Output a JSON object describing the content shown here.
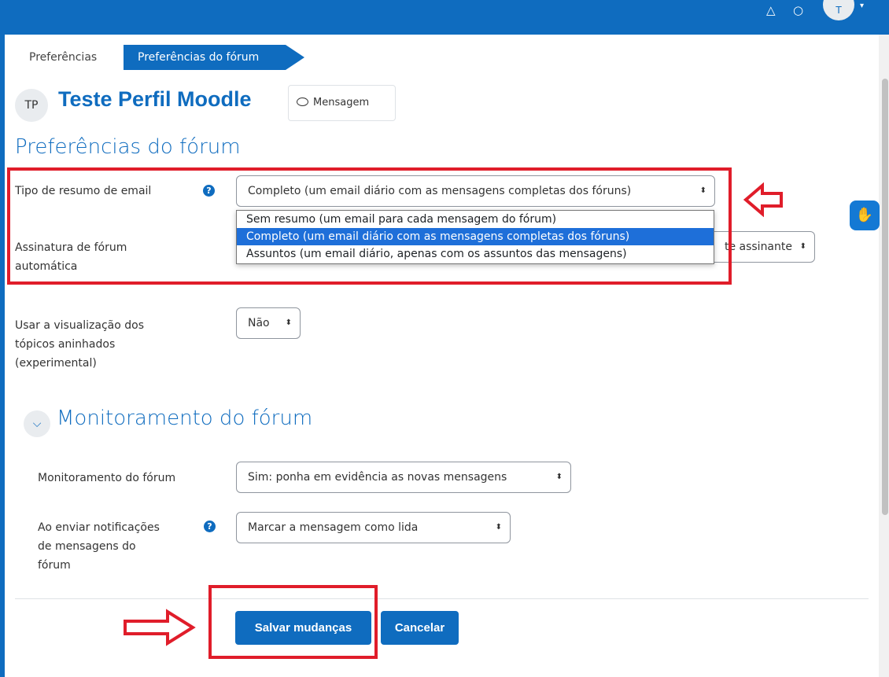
{
  "nav": {
    "avatar_initials": "T",
    "bell_icon": "bell-icon",
    "chat_icon": "chat-icon"
  },
  "breadcrumb": {
    "items": [
      "Preferências",
      "Preferências do fórum"
    ]
  },
  "profile": {
    "initials": "TP",
    "name": "Teste Perfil Moodle",
    "message_button": "Mensagem"
  },
  "page_title": "Preferências do fórum",
  "fields": {
    "digest": {
      "label": "Tipo de resumo de email",
      "value": "Completo (um email diário com as mensagens completas dos fóruns)",
      "options": [
        "Sem resumo (um email para cada mensagem do fórum)",
        "Completo (um email diário com as mensagens completas dos fóruns)",
        "Assuntos (um email diário, apenas com os assuntos das mensagens)"
      ],
      "selected_index": 1
    },
    "autosubscribe": {
      "label_line1": "Assinatura de fórum",
      "label_line2": "automática",
      "value_visible": "te assinante"
    },
    "threaded": {
      "label_line1": "Usar a visualização dos",
      "label_line2": "tópicos aninhados",
      "label_line3": "(experimental)",
      "value": "Não"
    }
  },
  "tracking_section": {
    "title": "Monitoramento do fórum",
    "tracking": {
      "label": "Monitoramento do fórum",
      "value": "Sim: ponha em evidência as novas mensagens"
    },
    "notifications": {
      "label_line1": "Ao enviar notificações",
      "label_line2": "de mensagens do",
      "label_line3": "fórum",
      "value": "Marcar a mensagem como lida"
    }
  },
  "actions": {
    "save": "Salvar mudanças",
    "cancel": "Cancelar"
  },
  "colors": {
    "brand": "#0f6cbf",
    "annotation_red": "#e01d2a",
    "selected_option": "#1e6fd9"
  }
}
